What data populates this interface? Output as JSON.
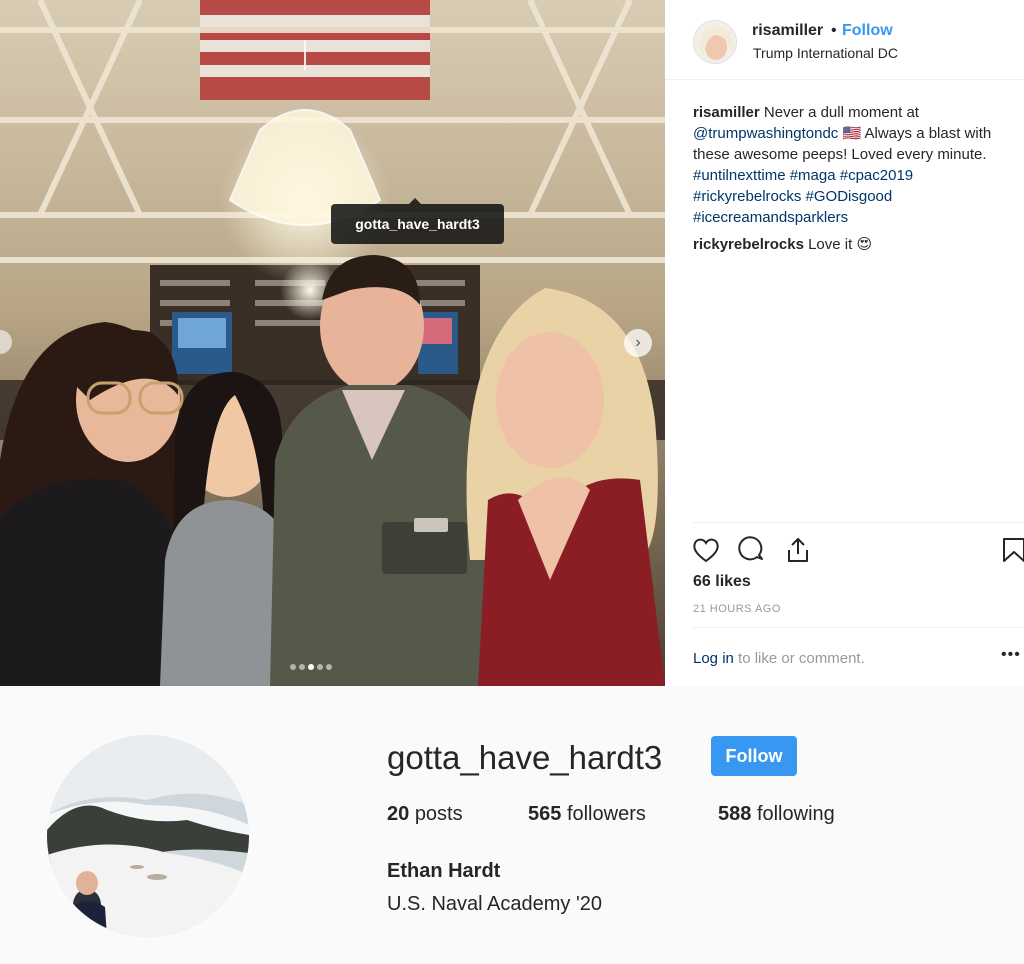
{
  "post": {
    "photo_tag": "gotta_have_hardt3",
    "carousel_dots": 5,
    "carousel_active_dot": 3,
    "owner": {
      "username": "risamiller",
      "separator": "•",
      "follow_label": "Follow",
      "location": "Trump International DC"
    },
    "caption": {
      "username": "risamiller",
      "text_1": "Never a dull moment at",
      "mention": "@trumpwashingtondc",
      "flag": "🇺🇸",
      "text_2": "Always a blast with these awesome peeps! Loved every minute.",
      "hashtags_line_1": "#untilnexttime #maga #cpac2019",
      "hashtags_line_2": "#rickyrebelrocks #GODisgood",
      "hashtags_line_3": "#icecreamandsparklers"
    },
    "comment": {
      "username": "rickyrebelrocks",
      "text": "Love it",
      "emoji": "😍"
    },
    "likes": "66 likes",
    "timestamp": "21 HOURS AGO",
    "login_link": "Log in",
    "login_text": "to like or comment.",
    "more_label": "•••",
    "icons": [
      "heart-icon",
      "comment-icon",
      "share-icon",
      "bookmark-icon"
    ]
  },
  "profile": {
    "username": "gotta_have_hardt3",
    "follow_label": "Follow",
    "posts_count": "20",
    "posts_label": "posts",
    "followers_count": "565",
    "followers_label": "followers",
    "following_count": "588",
    "following_label": "following",
    "full_name": "Ethan Hardt",
    "bio": "U.S. Naval Academy '20"
  },
  "colors": {
    "accent": "#3897f0",
    "link": "#003569",
    "muted": "#999999",
    "profile_bg": "#fafafa"
  }
}
